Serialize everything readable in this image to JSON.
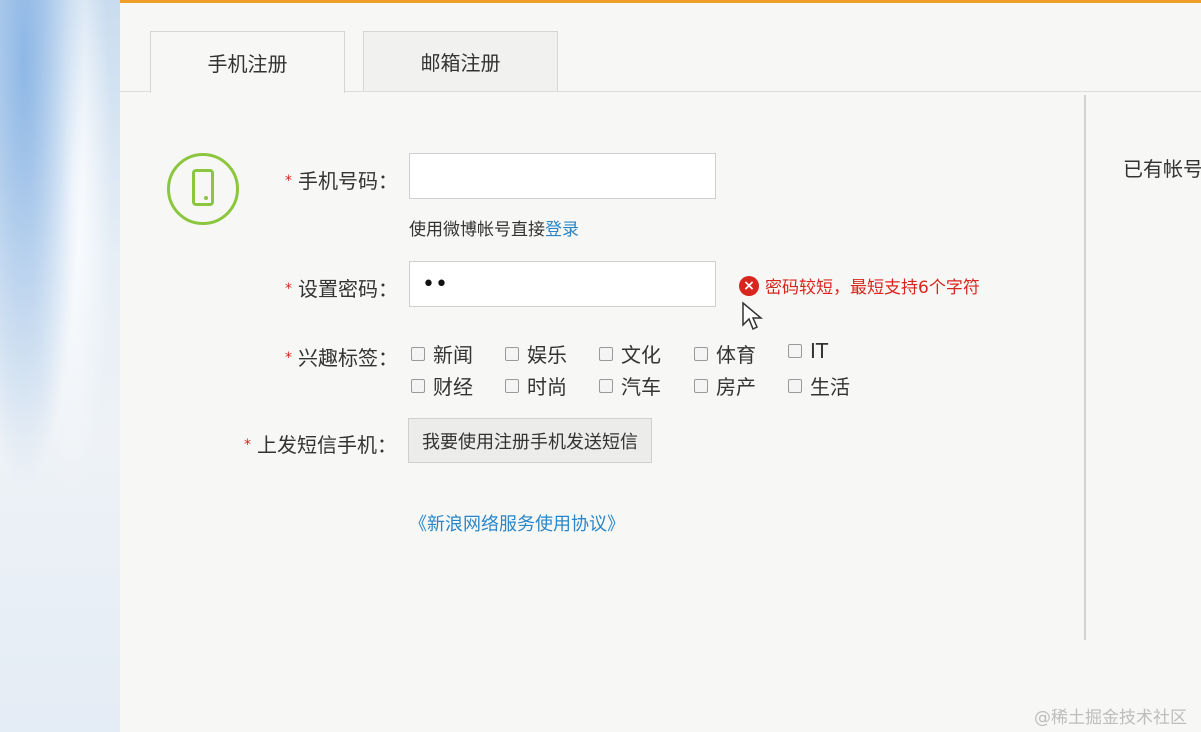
{
  "tabs": [
    {
      "label": "手机注册",
      "active": true
    },
    {
      "label": "邮箱注册",
      "active": false
    }
  ],
  "side": {
    "text": "已有帐号"
  },
  "form": {
    "required_mark": "*",
    "phone": {
      "label": "手机号码：",
      "value": "",
      "placeholder": ""
    },
    "weibo_hint": {
      "text": "使用微博帐号直接",
      "link": "登录"
    },
    "password": {
      "label": "设置密码：",
      "value": "••"
    },
    "password_error": "密码较短，最短支持6个字符",
    "interest": {
      "label": "兴趣标签：",
      "options": [
        "新闻",
        "娱乐",
        "文化",
        "体育",
        "IT",
        "财经",
        "时尚",
        "汽车",
        "房产",
        "生活"
      ]
    },
    "sms": {
      "label": "上发短信手机：",
      "button": "我要使用注册手机发送短信"
    },
    "agreement": "《新浪网络服务使用协议》"
  },
  "watermark": "@稀土掘金技术社区",
  "colors": {
    "accent": "#f0a02a",
    "link": "#2a86c8",
    "error": "#d8261e",
    "icon_green": "#8cc63f"
  },
  "icons": {
    "phone": "mobile-phone-icon",
    "error": "error-circle-icon",
    "cursor": "mouse-pointer-icon"
  }
}
